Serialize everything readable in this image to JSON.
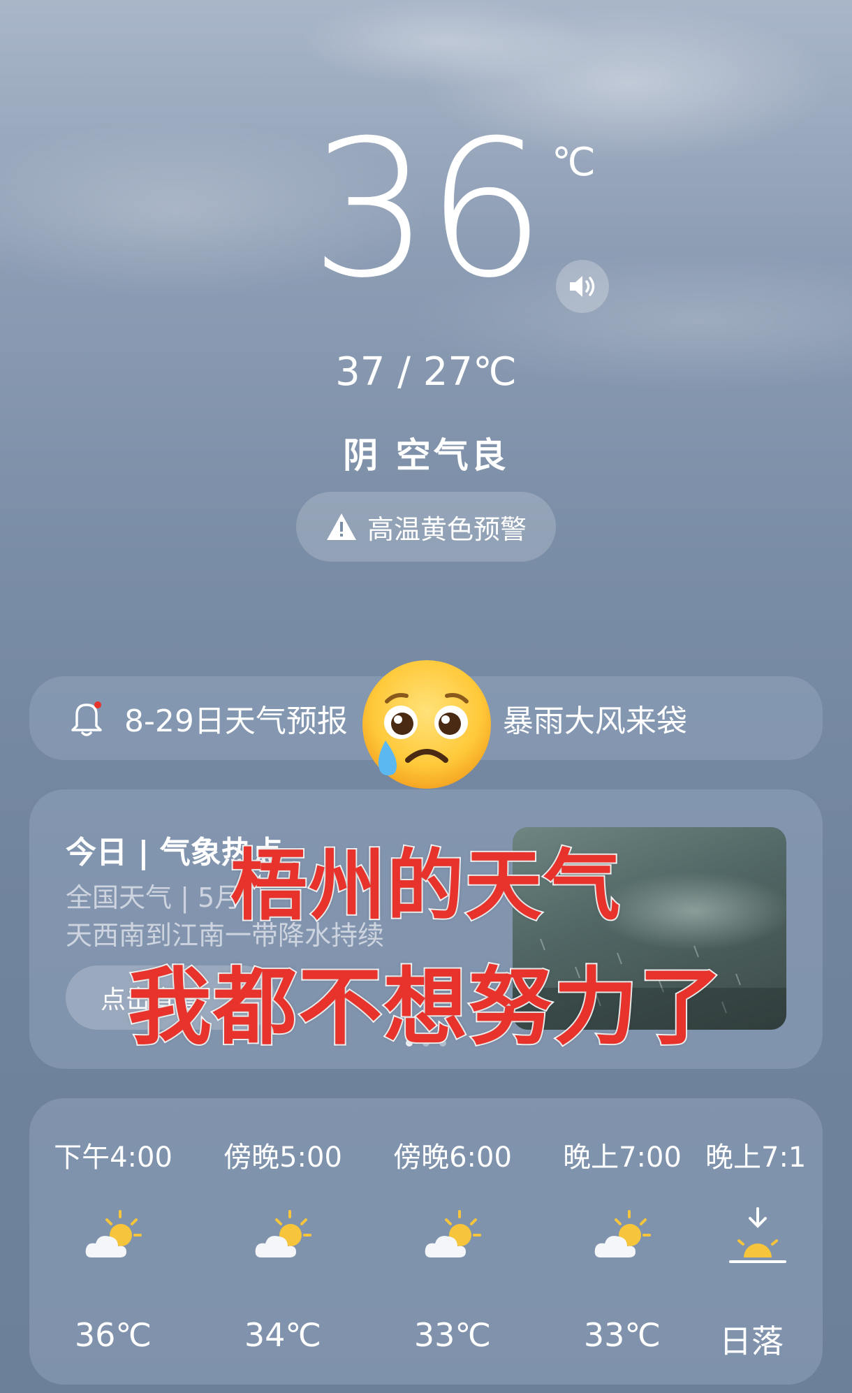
{
  "current": {
    "temperature": "36",
    "unit": "℃",
    "range": "37 / 27℃",
    "condition": "阴  空气良",
    "alert": "高温黄色预警"
  },
  "notice": {
    "text_left": "8-29日天气预报",
    "text_right": "暴雨大风来袋"
  },
  "hot_card": {
    "title": "今日 | 气象热点",
    "subtitle1": "全国天气 | 5月",
    "subtitle2": "天西南到江南一带降水持续",
    "button": "点击查看",
    "pager": {
      "count": 3,
      "active": 0
    }
  },
  "hourly": [
    {
      "time": "下午4:00",
      "icon": "partly-cloudy-sun-icon",
      "temp": "36℃"
    },
    {
      "time": "傍晚5:00",
      "icon": "partly-cloudy-sun-icon",
      "temp": "34℃"
    },
    {
      "time": "傍晚6:00",
      "icon": "partly-cloudy-sun-icon",
      "temp": "33℃"
    },
    {
      "time": "晚上7:00",
      "icon": "partly-cloudy-sun-icon",
      "temp": "33℃"
    },
    {
      "time": "晚上7:1",
      "icon": "sunset-icon",
      "temp": "日落"
    }
  ],
  "overlay": {
    "line1": "梧州的天气",
    "line2": "我都不想努力了"
  },
  "colors": {
    "overlay_text": "#e8322c",
    "overlay_stroke": "#ffffff",
    "sun": "#f6c53b"
  }
}
